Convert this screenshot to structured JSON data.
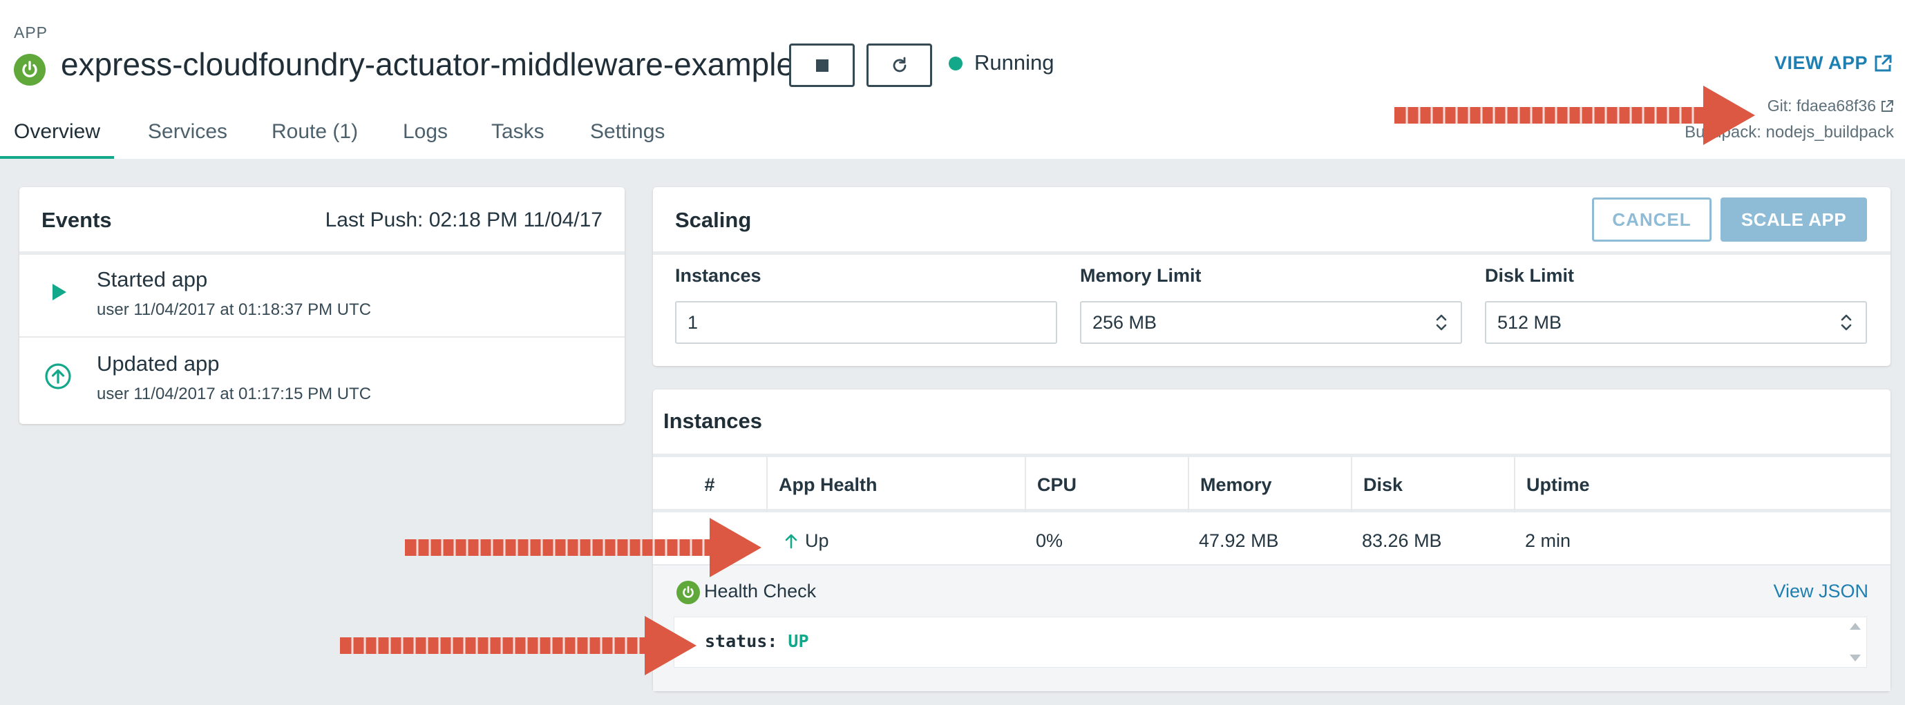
{
  "header": {
    "kicker": "APP",
    "app_name": "express-cloudfoundry-actuator-middleware-example",
    "status": "Running",
    "view_app": "VIEW APP",
    "git": "Git: fdaea68f36",
    "buildpack": "Buildpack: nodejs_buildpack"
  },
  "tabs": [
    "Overview",
    "Services",
    "Route (1)",
    "Logs",
    "Tasks",
    "Settings"
  ],
  "events": {
    "title": "Events",
    "last_push": "Last Push: 02:18 PM 11/04/17",
    "items": [
      {
        "title": "Started app",
        "meta": "user 11/04/2017 at 01:18:37 PM UTC",
        "icon": "play-icon"
      },
      {
        "title": "Updated app",
        "meta": "user 11/04/2017 at 01:17:15 PM UTC",
        "icon": "arrow-up-circle-icon"
      }
    ]
  },
  "scaling": {
    "title": "Scaling",
    "cancel": "CANCEL",
    "scale": "SCALE APP",
    "instances_label": "Instances",
    "instances_value": "1",
    "memory_label": "Memory Limit",
    "memory_value": "256 MB",
    "disk_label": "Disk Limit",
    "disk_value": "512 MB"
  },
  "instances": {
    "title": "Instances",
    "columns": [
      "#",
      "App Health",
      "CPU",
      "Memory",
      "Disk",
      "Uptime"
    ],
    "row": {
      "health": "Up",
      "cpu": "0%",
      "memory": "47.92 MB",
      "disk": "83.26 MB",
      "uptime": "2 min"
    },
    "health_check": "Health Check",
    "view_json": "View JSON",
    "json_key": "status:",
    "json_value": "UP"
  },
  "colors": {
    "accent": "#14a88b",
    "link": "#1e7fb3",
    "spring_green": "#5fa839",
    "button_disabled": "#8ebbd6",
    "annotation": "#dd5843"
  }
}
